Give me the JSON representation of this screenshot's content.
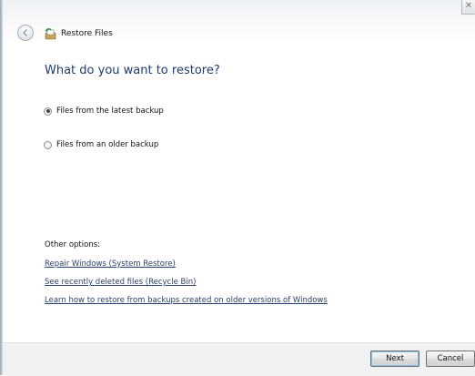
{
  "window": {
    "title": "Restore Files",
    "close_glyph": "✕"
  },
  "main": {
    "heading": "What do you want to restore?",
    "options": [
      {
        "label": "Files from the latest backup",
        "selected": true
      },
      {
        "label": "Files from an older backup",
        "selected": false
      }
    ],
    "other_options_label": "Other options:",
    "links": [
      "Repair Windows (System Restore)",
      "See recently deleted files (Recycle Bin)",
      "Learn how to restore from backups created on older versions of Windows"
    ]
  },
  "footer": {
    "next_label": "Next",
    "cancel_label": "Cancel"
  },
  "icons": {
    "back": "back-arrow-icon",
    "app": "restore-files-icon",
    "close": "close-icon"
  },
  "colors": {
    "heading": "#1e3a6e",
    "link": "#2a3f6b",
    "footer_bg": "#f0f1f3"
  }
}
